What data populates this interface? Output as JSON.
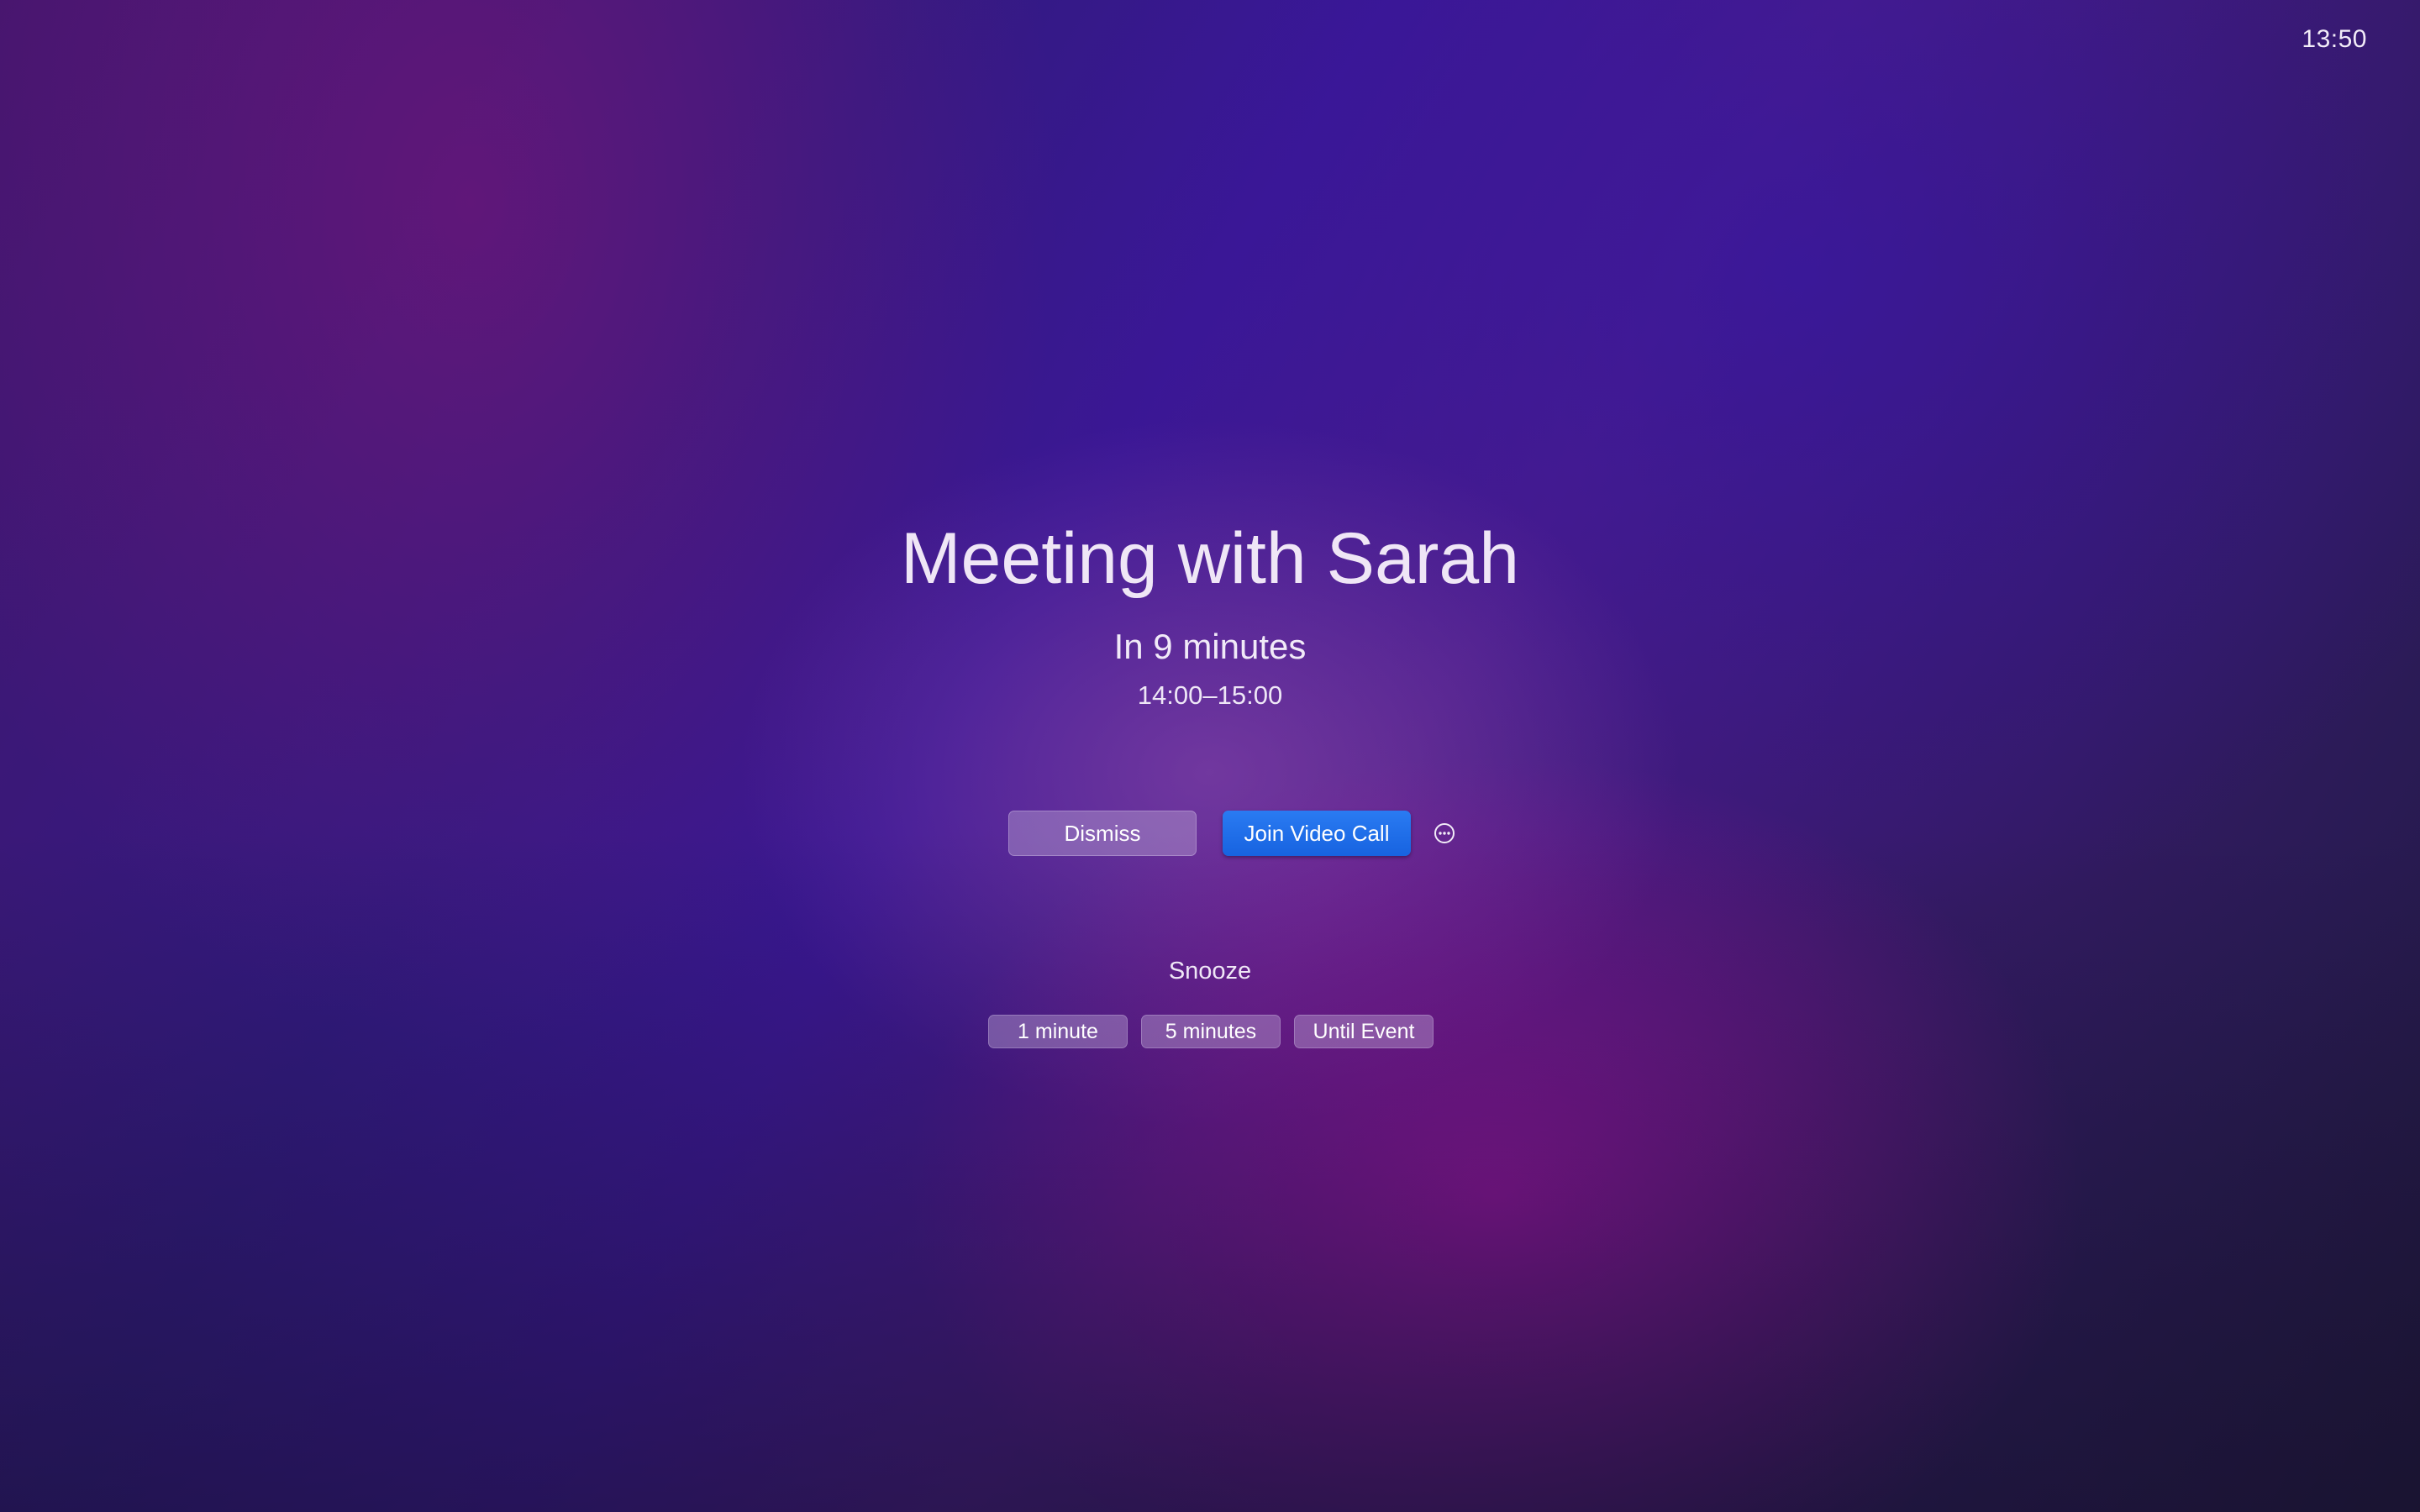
{
  "status_bar": {
    "clock": "13:50"
  },
  "event": {
    "title": "Meeting with Sarah",
    "relative_time": "In 9 minutes",
    "time_range": "14:00–15:00"
  },
  "actions": {
    "dismiss_label": "Dismiss",
    "join_label": "Join Video Call",
    "more_icon": "ellipsis-circle-icon"
  },
  "snooze": {
    "label": "Snooze",
    "options": [
      "1 minute",
      "5 minutes",
      "Until Event"
    ]
  },
  "colors": {
    "join_button": "#1f6fe8",
    "secondary_button": "#8a72b0",
    "background_primary": "#3b1794",
    "background_accent": "#9e12a0"
  }
}
